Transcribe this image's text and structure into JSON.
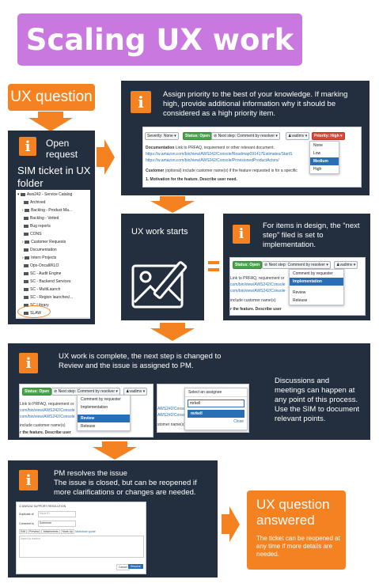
{
  "title": "Scaling UX work",
  "step1": {
    "label": "UX question"
  },
  "ticket_panel": {
    "open_request": "Open request",
    "folder_label": "SIM ticket in UX folder",
    "tree": [
      "Aws242 - Service Catalog",
      "Archived",
      "Backlog - Product Ma...",
      "Backlog - Vetted",
      "Bug reports",
      "CONS",
      "Customer Requests",
      "Documentation",
      "Intern Projects",
      "Ops-Oncall/KLO",
      "SC - Audit Engine",
      "SC - Backend Services",
      "SC - MultiLaunch",
      "SC - Region launches/...",
      "SC Library",
      "SLAW",
      "UX"
    ]
  },
  "priority_panel": {
    "text": "Assign priority to the best of your knowledge. If marking high, provide additional information why it should be considered as a high priority item.",
    "severity": "Severity: None ▾",
    "status": "Status: Open",
    "next_step": "Next step: Comment by resolver ▾",
    "user": "vadimv ▾",
    "priority": "Priority: High ▾",
    "doc_bold": "Documentation",
    "doc_text": "Link to PRFAQ, requirement or other relevant document.",
    "link1": "https://w.amazon.com/bin/view/AWS242/Console/Roadmap091417Estimates/StartS",
    "link2": "https://w.amazon.com/bin/view/AWS242/Console/ProvisionedProductActors/",
    "customer_bold": "Customer",
    "customer_text": "(optional) include customer name(s) if the feature requested is for a specific",
    "motivation": "1. Motivation for the feature. Describe user need.",
    "options": [
      "None",
      "Low",
      "Medium",
      "High"
    ]
  },
  "ux_start": {
    "label": "UX work starts"
  },
  "design_panel": {
    "text": "For items in design, the “next step” filed is set to implementation.",
    "status": "Status: Open",
    "next_step": "Next step: Comment by resolver ▾",
    "user": "vadimv ▾",
    "frag1": "Link to PRFAQ, requirement or",
    "frag2": "com/bin/view/AWS242/Console",
    "frag3": "com/bin/view/AWS242/Console",
    "frag4": "include customer name(s)",
    "frag5": "r the feature. Describe user",
    "options": [
      "Comment by requester",
      "Implementation",
      "Review",
      "Release"
    ]
  },
  "complete_panel": {
    "text": "UX work is complete, the next step is changed to Review and the issue is assigned to PM.",
    "side_text": "Discussions and meetings can happen at any point of this process. Use the SIM to document relevant points.",
    "status": "Status: Open",
    "next_step": "Next step: Comment by resolver ▾",
    "user": "vadimv ▾",
    "frag1": "Link to PRFAQ, requirement or",
    "frag2": "com/bin/view/AWS242/Console",
    "frag3": "com/bin/view/AWS242/Console",
    "frag4": "include customer name(s)",
    "frag5": "r the feature. Describe user",
    "options": [
      "Comment by requester",
      "Implementation",
      "Review",
      "Release"
    ],
    "assignee_title": "Select an assignee",
    "assignee_value": "mrkell",
    "assignee_option": "mrkell",
    "close": "Close",
    "frag6": "AWS242/Console",
    "frag7": "AWS242/Console",
    "frag8": "stomer name(s)"
  },
  "resolve_panel": {
    "title": "PM resolves the issue",
    "text": "The issue is closed, but can be reopened if more clarifications or changes are needed.",
    "form_header": "AWS242 SUPPORT RESOLUTION",
    "dup_label": "Duplicate of",
    "dup_placeholder": "Issue ID",
    "comment_label": "Comment to",
    "comment_value": "Someone",
    "tabs": [
      "Edit",
      "Preview",
      "Attachments",
      "Mark Up"
    ],
    "markdown": "Markdown guide",
    "textarea": "Insert to resolve",
    "cancel": "Cancel",
    "resolve": "Resolve"
  },
  "final": {
    "title": "UX question answered",
    "text": "The ticket can be reopened at any time if more details are needed."
  },
  "colors": {
    "orange": "#f58220",
    "dark": "#232f3e",
    "purple": "#c978e0"
  }
}
